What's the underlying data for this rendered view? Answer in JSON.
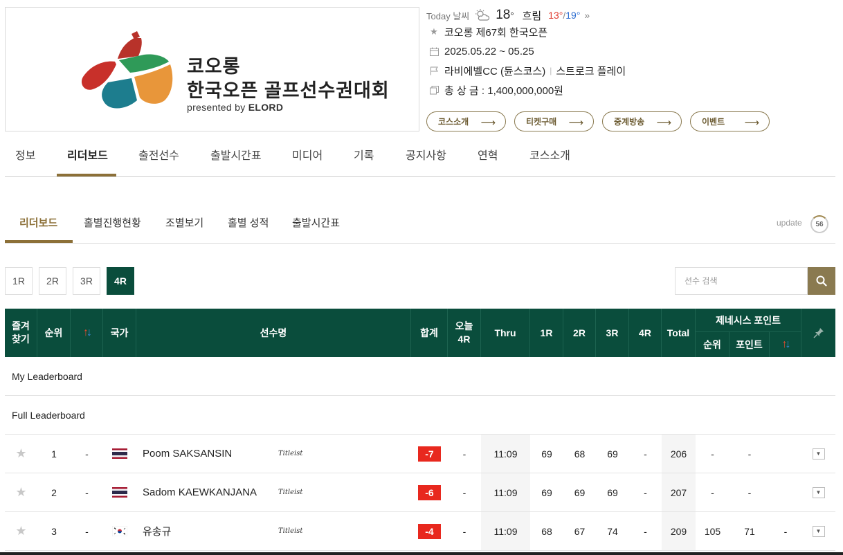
{
  "logo": {
    "line1": "코오롱",
    "line2": "한국오픈 골프선수권대회",
    "presented_prefix": "presented by ",
    "presented_brand": "ELORD"
  },
  "weather": {
    "today_label": "Today 날씨",
    "icon": "partly-cloudy-icon",
    "temp": "18",
    "deg": "°",
    "desc": "흐림",
    "low": "13°",
    "sep": "/",
    "high": "19°",
    "more": "»"
  },
  "tournament": {
    "name": "코오롱 제67회 한국오픈",
    "dates": "2025.05.22 ~ 05.25",
    "venue": "라비에벨CC (듄스코스)",
    "format": "스트로크 플레이",
    "prize": "총 상 금 : 1,400,000,000원"
  },
  "pills": [
    {
      "label": "코스소개"
    },
    {
      "label": "티켓구매"
    },
    {
      "label": "중계방송"
    },
    {
      "label": "이벤트"
    }
  ],
  "main_nav": [
    "정보",
    "리더보드",
    "출전선수",
    "출발시간표",
    "미디어",
    "기록",
    "공지사항",
    "연혁",
    "코스소개"
  ],
  "sub_nav": [
    "리더보드",
    "홀별진행현황",
    "조별보기",
    "홀별 성적",
    "출발시간표"
  ],
  "update": {
    "label": "update",
    "count": "56"
  },
  "rounds": [
    "1R",
    "2R",
    "3R",
    "4R"
  ],
  "search": {
    "placeholder": "선수 검색",
    "value": ""
  },
  "table_headers": {
    "fav_line1": "즐겨",
    "fav_line2": "찾기",
    "rank": "순위",
    "country": "국가",
    "player": "선수명",
    "total_score": "합계",
    "today_line1": "오늘",
    "today_line2": "4R",
    "thru": "Thru",
    "r1": "1R",
    "r2": "2R",
    "r3": "3R",
    "r4": "4R",
    "total": "Total",
    "genesis": "제네시스 포인트",
    "g_rank": "순위",
    "g_points": "포인트",
    "sort_up": "↑",
    "sort_down": "↓"
  },
  "sections": {
    "my": "My Leaderboard",
    "full": "Full Leaderboard"
  },
  "rows": [
    {
      "rank": "1",
      "move": "-",
      "flag": "thailand",
      "name": "Poom SAKSANSIN",
      "brand": "Titleist",
      "score": "-7",
      "today": "-",
      "thru": "11:09",
      "r1": "69",
      "r2": "68",
      "r3": "69",
      "r4": "-",
      "total": "206",
      "g_rank": "-",
      "g_points": "-",
      "g_move": ""
    },
    {
      "rank": "2",
      "move": "-",
      "flag": "thailand",
      "name": "Sadom KAEWKANJANA",
      "brand": "Titleist",
      "score": "-6",
      "today": "-",
      "thru": "11:09",
      "r1": "69",
      "r2": "69",
      "r3": "69",
      "r4": "-",
      "total": "207",
      "g_rank": "-",
      "g_points": "-",
      "g_move": ""
    },
    {
      "rank": "3",
      "move": "-",
      "flag": "korea",
      "name": "유송규",
      "brand": "Titleist",
      "score": "-4",
      "today": "-",
      "thru": "11:09",
      "r1": "68",
      "r2": "67",
      "r3": "74",
      "r4": "-",
      "total": "209",
      "g_rank": "105",
      "g_points": "71",
      "g_move": "-"
    }
  ],
  "colors": {
    "header_green": "#0a4d3c",
    "accent_gold": "#8c7038",
    "score_red": "#e8281e"
  }
}
